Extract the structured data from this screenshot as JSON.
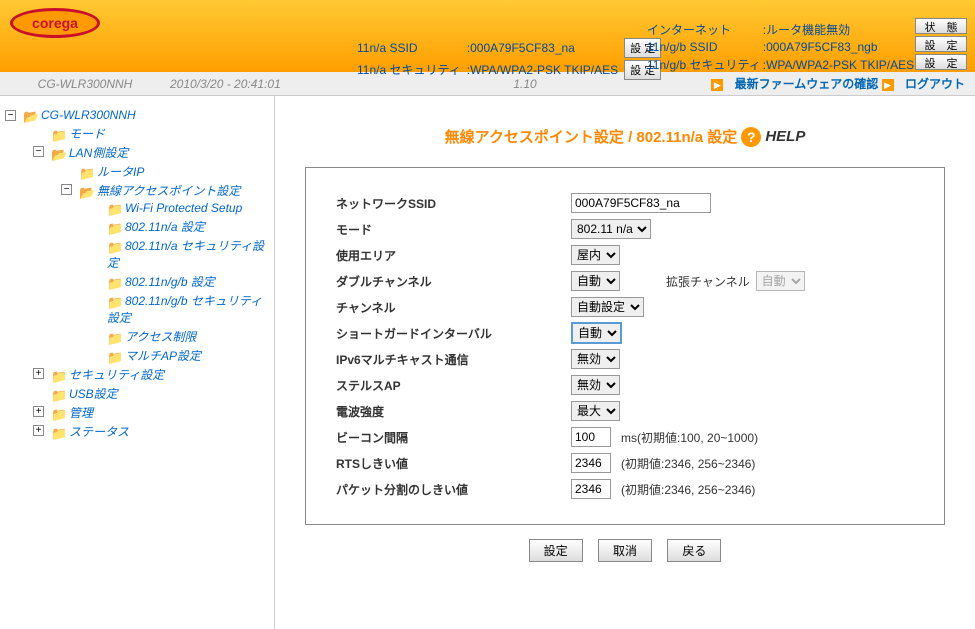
{
  "logo_text": "corega",
  "header": {
    "na_ssid_label": "11n/a SSID",
    "na_ssid_value": ":000A79F5CF83_na",
    "na_sec_label": "11n/a セキュリティ",
    "na_sec_value": ":WPA/WPA2-PSK TKIP/AES",
    "btn": "設 定",
    "internet_label": "インターネット",
    "internet_value": ":ルータ機能無効",
    "ngb_ssid_label": "11n/g/b SSID",
    "ngb_ssid_value": ":000A79F5CF83_ngb",
    "ngb_sec_label": "11n/g/b セキュリティ",
    "ngb_sec_value": ":WPA/WPA2-PSK TKIP/AES",
    "btn_stat": "状 態",
    "btn_set": "設 定"
  },
  "statusbar": {
    "model": "CG-WLR300NNH",
    "timestamp": "2010/3/20 - 20:41:01",
    "version": "1.10",
    "firmware": "最新ファームウェアの確認",
    "logout": "ログアウト"
  },
  "tree": {
    "root": "CG-WLR300NNH",
    "mode": "モード",
    "lan": "LAN側設定",
    "routerip": "ルータIP",
    "wap": "無線アクセスポイント設定",
    "wps": "Wi-Fi Protected Setup",
    "na": "802.11n/a 設定",
    "na_sec": "802.11n/a セキュリティ設定",
    "ngb": "802.11n/g/b 設定",
    "ngb_sec": "802.11n/g/b セキュリティ設定",
    "access": "アクセス制限",
    "multiap": "マルチAP設定",
    "security": "セキュリティ設定",
    "usb": "USB設定",
    "admin": "管理",
    "status": "ステータス"
  },
  "page": {
    "title": "無線アクセスポイント設定 / 802.11n/a 設定",
    "help": "HELP"
  },
  "form": {
    "ssid_label": "ネットワークSSID",
    "ssid_value": "000A79F5CF83_na",
    "mode_label": "モード",
    "mode_value": "802.11 n/a",
    "area_label": "使用エリア",
    "area_value": "屋内",
    "dbl_label": "ダブルチャンネル",
    "dbl_value": "自動",
    "ext_label": "拡張チャンネル",
    "ext_value": "自動",
    "ch_label": "チャンネル",
    "ch_value": "自動設定",
    "sgi_label": "ショートガードインターバル",
    "sgi_value": "自動",
    "ipv6_label": "IPv6マルチキャスト通信",
    "ipv6_value": "無効",
    "stealth_label": "ステルスAP",
    "stealth_value": "無効",
    "power_label": "電波強度",
    "power_value": "最大",
    "beacon_label": "ビーコン間隔",
    "beacon_value": "100",
    "beacon_hint": "ms(初期値:100, 20~1000)",
    "rts_label": "RTSしきい値",
    "rts_value": "2346",
    "rts_hint": "(初期値:2346, 256~2346)",
    "frag_label": "パケット分割のしきい値",
    "frag_value": "2346",
    "frag_hint": "(初期値:2346, 256~2346)"
  },
  "buttons": {
    "set": "設定",
    "cancel": "取消",
    "back": "戻る"
  }
}
